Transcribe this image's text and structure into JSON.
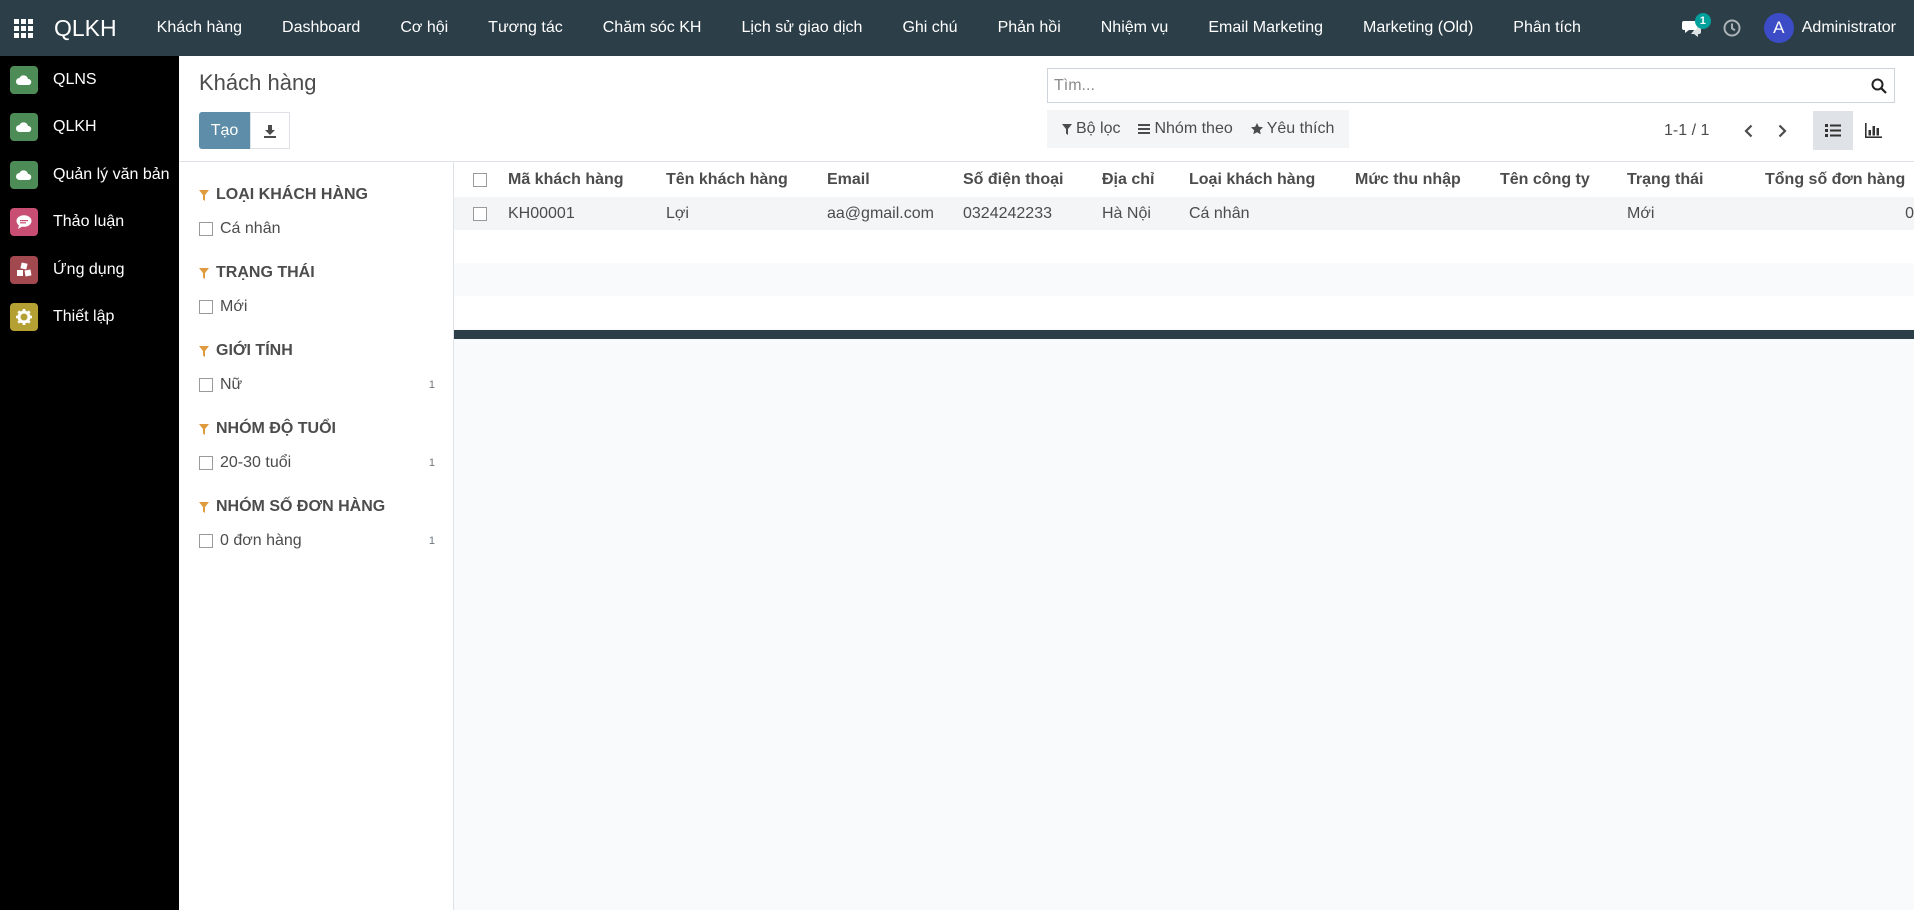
{
  "navbar": {
    "brand": "QLKH",
    "menu": [
      "Khách hàng",
      "Dashboard",
      "Cơ hội",
      "Tương tác",
      "Chăm sóc KH",
      "Lịch sử giao dịch",
      "Ghi chú",
      "Phản hồi",
      "Nhiệm vụ",
      "Email Marketing",
      "Marketing (Old)",
      "Phân tích"
    ],
    "message_count": "1",
    "user_initial": "A",
    "user_name": "Administrator",
    "bg_color": "#2c3e48"
  },
  "sidebar": {
    "items": [
      {
        "label": "QLNS",
        "icon": "cloud-icon"
      },
      {
        "label": "QLKH",
        "icon": "cloud-icon"
      },
      {
        "label": "Quản lý văn bản",
        "icon": "cloud-icon"
      },
      {
        "label": "Thảo luận",
        "icon": "chat-icon"
      },
      {
        "label": "Ứng dụng",
        "icon": "apps-cubes-icon"
      },
      {
        "label": "Thiết lập",
        "icon": "gear-icon"
      }
    ]
  },
  "control": {
    "title": "Khách hàng",
    "create_label": "Tạo",
    "search_placeholder": "Tìm...",
    "filter_label": "Bộ lọc",
    "group_label": "Nhóm theo",
    "favorite_label": "Yêu thích",
    "pager_value": "1-1 / 1",
    "accent_color": "#5d8da8"
  },
  "searchpanel": {
    "sections": [
      {
        "title": "LOẠI KHÁCH HÀNG",
        "items": [
          {
            "label": "Cá nhân",
            "count": ""
          }
        ]
      },
      {
        "title": "TRẠNG THÁI",
        "items": [
          {
            "label": "Mới",
            "count": ""
          }
        ]
      },
      {
        "title": "GIỚI TÍNH",
        "items": [
          {
            "label": "Nữ",
            "count": "1"
          }
        ]
      },
      {
        "title": "NHÓM ĐỘ TUỔI",
        "items": [
          {
            "label": "20-30 tuổi",
            "count": "1"
          }
        ]
      },
      {
        "title": "NHÓM SỐ ĐƠN HÀNG",
        "items": [
          {
            "label": "0 đơn hàng",
            "count": "1"
          }
        ]
      }
    ]
  },
  "list": {
    "columns": [
      "Mã khách hàng",
      "Tên khách hàng",
      "Email",
      "Số điện thoại",
      "Địa chỉ",
      "Loại khách hàng",
      "Mức thu nhập",
      "Tên công ty",
      "Trạng thái",
      "Tổng số đơn hàng"
    ],
    "rows": [
      [
        "KH00001",
        "Lợi",
        "aa@gmail.com",
        "0324242233",
        "Hà Nội",
        "Cá nhân",
        "",
        "",
        "Mới",
        "0"
      ]
    ]
  }
}
